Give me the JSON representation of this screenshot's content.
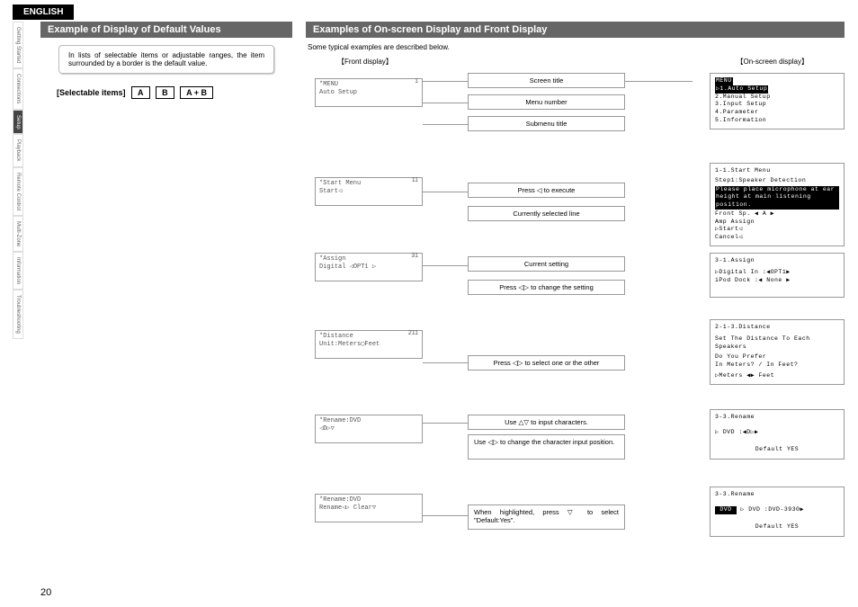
{
  "tab": "ENGLISH",
  "side_nav": [
    "Getting Started",
    "Connections",
    "Setup",
    "Playback",
    "Remote Control",
    "Multi-Zone",
    "Information",
    "Troubleshooting"
  ],
  "side_nav_active": 2,
  "page_number": "20",
  "left": {
    "header": "Example of Display of Default Values",
    "note": "In lists of selectable items or adjustable ranges, the item surrounded by a border is the default value.",
    "selectable_label": "[Selectable items]",
    "opts": [
      "A",
      "B",
      "A + B"
    ]
  },
  "right": {
    "header": "Examples of On-screen Display and Front Display",
    "intro": "Some typical examples are described below.",
    "front_display_label": "【Front display】",
    "osd_label": "【On-screen display】",
    "front": [
      {
        "num": "1",
        "l1": "*MENU",
        "l2": "Auto Setup"
      },
      {
        "num": "11",
        "l1": "*Start Menu",
        "l2": "Start◁"
      },
      {
        "num": "31",
        "l1": "*Assign",
        "l2": "Digital ◁OPT1 ▷"
      },
      {
        "num": "211",
        "l1": "*Distance",
        "l2": "Unit:Meters◯Feet"
      },
      {
        "num": "",
        "l1": "*Rename:DVD",
        "l2": "◁D▷▽"
      },
      {
        "num": "",
        "l1": "*Rename:DVD",
        "l2": "Rename◁▷ Clear▽"
      }
    ],
    "mid": [
      "Screen title",
      "Menu number",
      "Submenu title",
      "Press ◁ to execute",
      "Currently selected line",
      "Current setting",
      "Press ◁▷ to change the setting",
      "Press ◁▷ to select one or the other",
      "Use △▽ to input characters.",
      "Use ◁▷ to change the character input position.",
      "When highlighted, press ▽ to select \"Default:Yes\"."
    ],
    "osd": {
      "menu": {
        "title": "MENU",
        "items": [
          "▷1.Auto Setup",
          "  2.Manual Setup",
          "  3.Input Setup",
          "  4.Parameter",
          "  5.Information"
        ]
      },
      "start": {
        "title": "1-1.Start Menu",
        "step": "Step1:Speaker Detection",
        "msg": "Please place microphone at ear height at main listening position.",
        "lines": [
          "  Front Sp. ◀ A ▶",
          "  Amp Assign",
          "▷Start◁",
          "  Cancel◁"
        ]
      },
      "assign": {
        "title": "3-1.Assign",
        "lines": [
          "▷Digital In  :◀OPT1▶",
          "  iPod Dock  :◀ None ▶"
        ]
      },
      "distance": {
        "title": "2-1-3.Distance",
        "l1": "Set The Distance To Each Speakers",
        "l2": "Do You Prefer",
        "l3": "In Meters? / In Feet?",
        "l4": "▷Meters ◀▶ Feet"
      },
      "rename1": {
        "title": "3-3.Rename",
        "row": "▷ DVD  :◀D▷▶",
        "def": "Default YES"
      },
      "rename2": {
        "title": "3-3.Rename",
        "row": "▷ DVD  :DVD-3930▶",
        "def": "Default YES"
      }
    }
  }
}
